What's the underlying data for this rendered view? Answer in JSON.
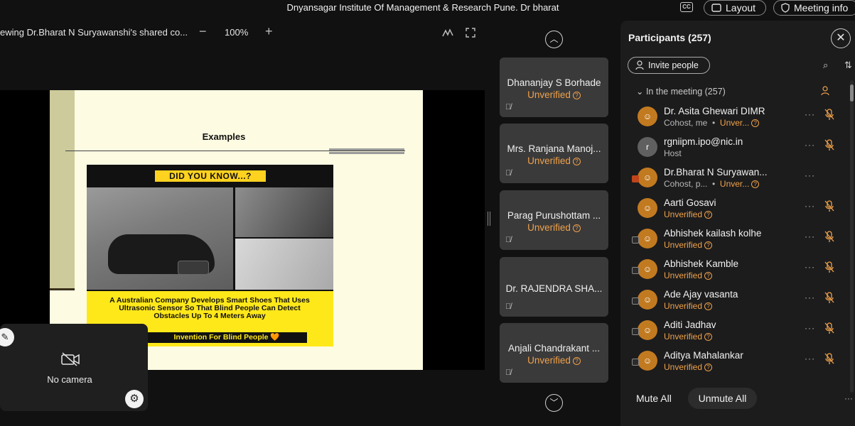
{
  "window": {
    "title": "Dnyansagar Institute Of Management & Research Pune. Dr bharat",
    "cc_label": "CC",
    "layout_label": "Layout",
    "meeting_info_label": "Meeting info"
  },
  "share_toolbar": {
    "label": "ewing Dr.Bharat N Suryawanshi's shared co...",
    "zoom_out": "−",
    "zoom": "100%",
    "zoom_in": "+"
  },
  "slide": {
    "title": "Examples",
    "poster_header": "DID YOU KNOW...?",
    "poster_text": "A Australian Company Develops Smart Shoes That Uses Ultrasonic Sensor So That Blind People Can Detect Obstacles Up To 4 Meters Away",
    "poster_footer": "Invention For Blind People 🧡"
  },
  "self_view": {
    "label": "No camera"
  },
  "video_strip": {
    "tiles": [
      {
        "name": "Dhananjay S Borhade",
        "status": "Unverified"
      },
      {
        "name": "Mrs. Ranjana Manoj...",
        "status": "Unverified"
      },
      {
        "name": "Parag Purushottam ...",
        "status": "Unverified"
      },
      {
        "name": "Dr. RAJENDRA SHA...",
        "status": ""
      },
      {
        "name": "Anjali Chandrakant ...",
        "status": "Unverified"
      }
    ]
  },
  "participants": {
    "title": "Participants (257)",
    "invite_label": "Invite people",
    "section_label": "In the meeting (257)",
    "list": [
      {
        "initial": "",
        "name": "Dr. Asita Ghewari DIMR",
        "role": "Cohost, me",
        "status": "Unver..."
      },
      {
        "initial": "r",
        "name": "rgniipm.ipo@nic.in",
        "role": "Host",
        "status": ""
      },
      {
        "initial": "",
        "name": "Dr.Bharat N Suryawan...",
        "role": "Cohost, p...",
        "status": "Unver..."
      },
      {
        "initial": "",
        "name": "Aarti Gosavi",
        "role": "",
        "status": "Unverified"
      },
      {
        "initial": "",
        "name": "Abhishek kailash kolhe",
        "role": "",
        "status": "Unverified"
      },
      {
        "initial": "",
        "name": "Abhishek Kamble",
        "role": "",
        "status": "Unverified"
      },
      {
        "initial": "",
        "name": "Ade Ajay vasanta",
        "role": "",
        "status": "Unverified"
      },
      {
        "initial": "",
        "name": "Aditi Jadhav",
        "role": "",
        "status": "Unverified"
      },
      {
        "initial": "",
        "name": "Aditya Mahalankar",
        "role": "",
        "status": "Unverified"
      }
    ],
    "mute_all_label": "Mute All",
    "unmute_all_label": "Unmute All"
  },
  "colors": {
    "accent_orange": "#f0a24a",
    "avatar_orange": "#c27a20",
    "panel_bg": "#1c1c1d",
    "tile_bg": "#3a3a3b"
  }
}
